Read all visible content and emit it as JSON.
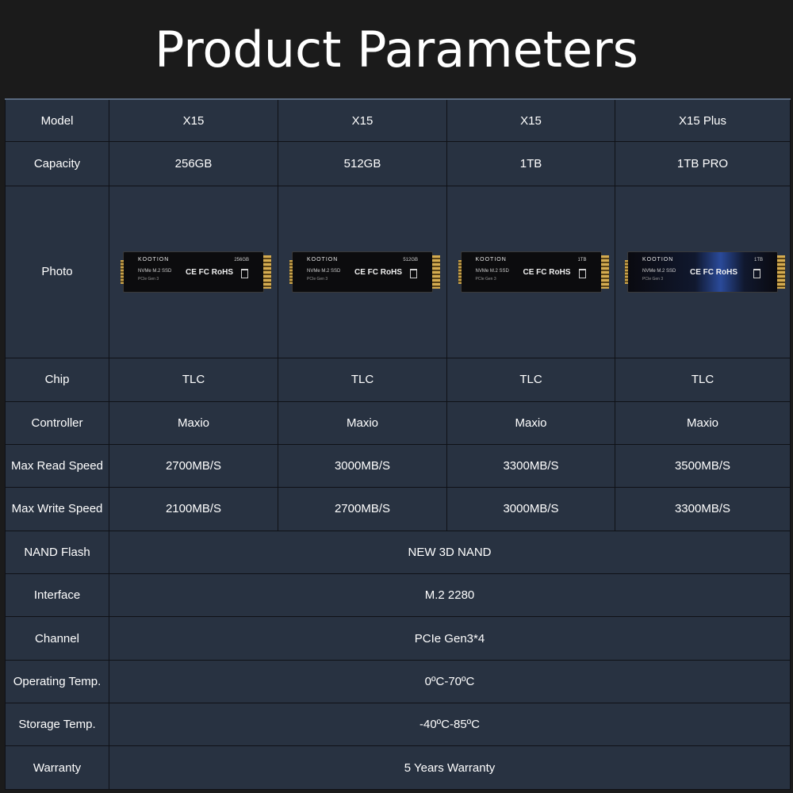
{
  "title": "Product Parameters",
  "table": {
    "model": {
      "label": "Model",
      "values": [
        "X15",
        "X15",
        "X15",
        "X15 Plus"
      ]
    },
    "capacity": {
      "label": "Capacity",
      "values": [
        "256GB",
        "512GB",
        "1TB",
        "1TB PRO"
      ]
    },
    "photo": {
      "label": "Photo",
      "items": [
        {
          "brand": "KOOTION",
          "capacity": "256GB",
          "type": "NVMe M.2 SSD",
          "gen": "PCIe Gen 3",
          "cert": "CE FC RoHS"
        },
        {
          "brand": "KOOTION",
          "capacity": "512GB",
          "type": "NVMe M.2 SSD",
          "gen": "PCIe Gen 3",
          "cert": "CE FC RoHS"
        },
        {
          "brand": "KOOTION",
          "capacity": "1TB",
          "type": "NVMe M.2 SSD",
          "gen": "PCIe Gen 3",
          "cert": "CE FC RoHS"
        },
        {
          "brand": "KOOTION",
          "capacity": "1TB",
          "type": "NVMe M.2 SSD",
          "gen": "PCIe Gen 3",
          "cert": "CE FC RoHS"
        }
      ]
    },
    "chip": {
      "label": "Chip",
      "values": [
        "TLC",
        "TLC",
        "TLC",
        "TLC"
      ]
    },
    "controller": {
      "label": "Controller",
      "values": [
        "Maxio",
        "Maxio",
        "Maxio",
        "Maxio"
      ]
    },
    "read_speed": {
      "label": "Max Read Speed",
      "values": [
        "2700MB/S",
        "3000MB/S",
        "3300MB/S",
        "3500MB/S"
      ]
    },
    "write_speed": {
      "label": "Max Write Speed",
      "values": [
        "2100MB/S",
        "2700MB/S",
        "3000MB/S",
        "3300MB/S"
      ]
    },
    "nand": {
      "label": "NAND Flash",
      "value": "NEW 3D NAND"
    },
    "interface": {
      "label": "Interface",
      "value": "M.2 2280"
    },
    "channel": {
      "label": "Channel",
      "value": "PCIe Gen3*4"
    },
    "op_temp": {
      "label": "Operating Temp.",
      "value": "0ºC-70ºC"
    },
    "storage_temp": {
      "label": "Storage Temp.",
      "value": "-40ºC-85ºC"
    },
    "warranty": {
      "label": "Warranty",
      "value": "5 Years Warranty"
    }
  },
  "colors": {
    "background": "#1b1b1b",
    "cell": "#283241",
    "border": "#0f1116",
    "text": "#ffffff"
  }
}
